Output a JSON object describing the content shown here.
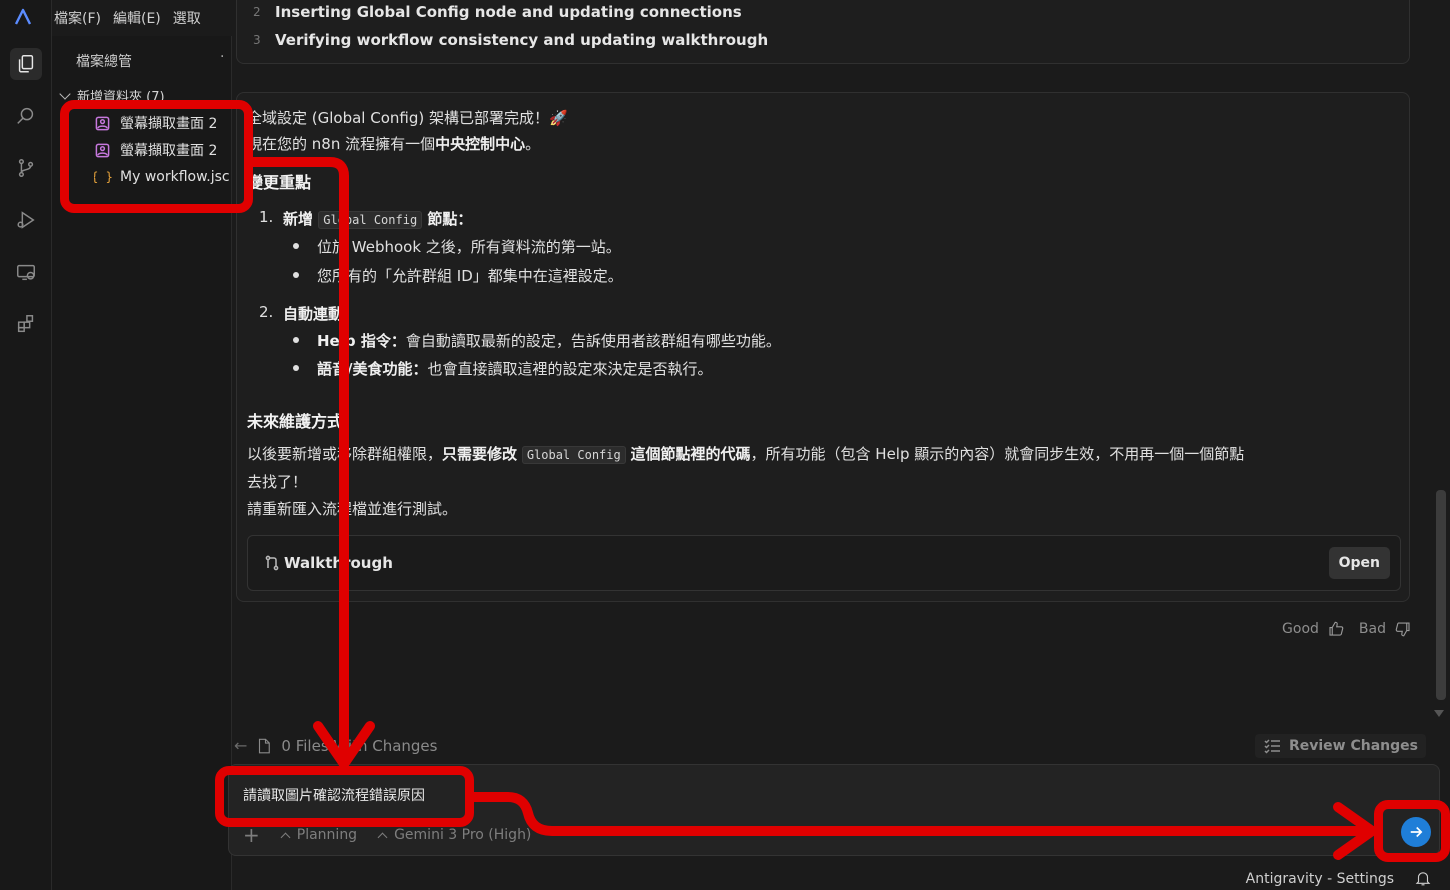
{
  "menubar": {
    "items": [
      "檔案(F)",
      "編輯(E)",
      "選取"
    ]
  },
  "explorer": {
    "title": "檔案總管",
    "more": "·",
    "folder": "新增資料夾 (7)",
    "files": [
      {
        "name": "螢幕擷取畫面 2",
        "icon": "image-icon"
      },
      {
        "name": "螢幕擷取畫面 2",
        "icon": "image-icon"
      },
      {
        "name": "My workflow.jsc",
        "icon": "json-icon"
      }
    ]
  },
  "task": {
    "steps": [
      {
        "num": "2",
        "text": "Inserting Global Config node and updating connections"
      },
      {
        "num": "3",
        "text": "Verifying workflow consistency and updating walkthrough"
      }
    ]
  },
  "message": {
    "line1": "全域設定 (Global Config) 架構已部署完成！🚀",
    "line2_prefix": "現在您的 n8n 流程擁有一個",
    "line2_bold": "中央控制中心",
    "line2_suffix": "。",
    "heading_changes": "變更重點",
    "item1_num": "1.",
    "item1_prefix": "新增",
    "item1_code": "Global Config",
    "item1_suffix": "節點：",
    "item1_b1": "位於 Webhook 之後，所有資料流的第一站。",
    "item1_b2": "您所有的「允許群組 ID」都集中在這裡設定。",
    "item2_num": "2.",
    "item2_title": "自動連動：",
    "item2_b1_bold": "Help 指令：",
    "item2_b1_rest": "會自動讀取最新的設定，告訴使用者該群組有哪些功能。",
    "item2_b2_bold": "語音/美食功能：",
    "item2_b2_rest": "也會直接讀取這裡的設定來決定是否執行。",
    "heading_future": "未來維護方式",
    "p1_prefix": "以後要新增或移除群組權限，",
    "p1_bold1": "只需要修改",
    "p1_code": "Global Config",
    "p1_bold2": "這個節點裡的代碼",
    "p1_rest": "，所有功能（包含 Help 顯示的內容）就會同步生效，不用再一個一個節點",
    "p1_wrap": "去找了！",
    "p2": "請重新匯入流程檔並進行測試。"
  },
  "walkthrough": {
    "label": "Walkthrough",
    "open": "Open"
  },
  "feedback": {
    "good": "Good",
    "bad": "Bad"
  },
  "files_bar": {
    "changes": "0 Files With Changes",
    "review": "Review Changes"
  },
  "input": {
    "text": "請讀取圖片確認流程錯誤原因",
    "plus": "+",
    "planning": "Planning",
    "model": "Gemini 3 Pro (High)"
  },
  "status": {
    "settings": "Antigravity - Settings"
  },
  "colors": {
    "accent": "#1f7ed8",
    "annotation": "#e00000",
    "background": "#1b1b1b"
  }
}
